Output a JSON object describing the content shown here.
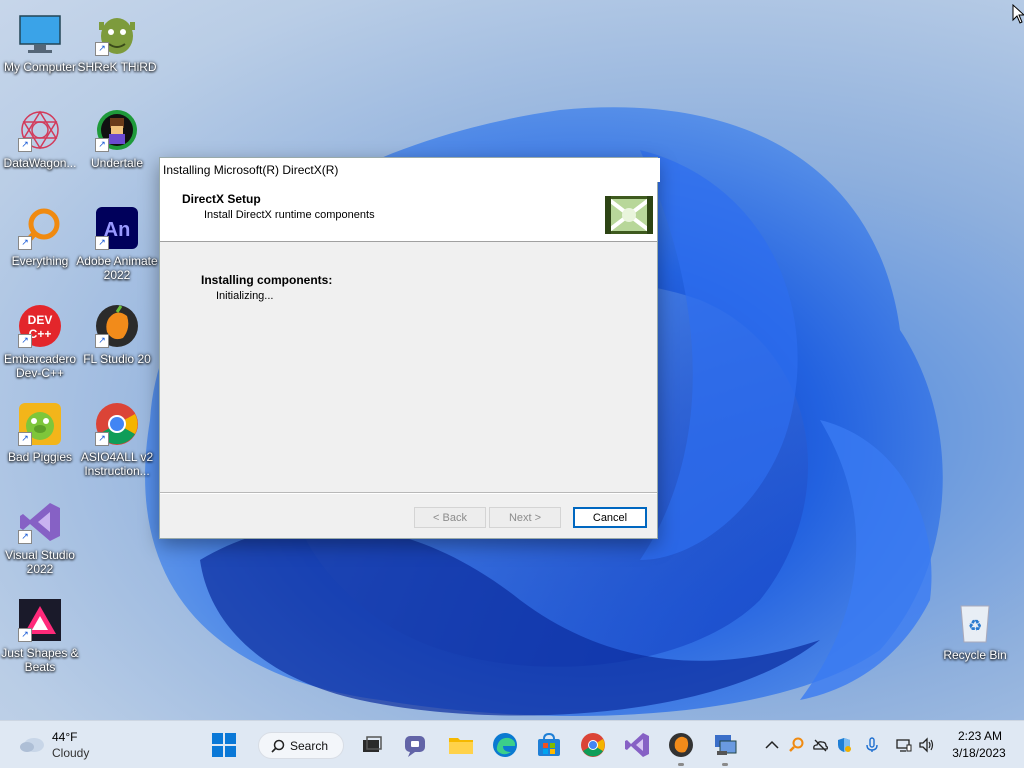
{
  "desktop": {
    "icons": [
      {
        "label": "My Computer"
      },
      {
        "label": "SHReK THiRD"
      },
      {
        "label": "DataWagon..."
      },
      {
        "label": "Undertale"
      },
      {
        "label": "Everything"
      },
      {
        "label": "Adobe Animate 2022"
      },
      {
        "label": "Embarcadero Dev-C++"
      },
      {
        "label": "FL Studio 20"
      },
      {
        "label": "Bad Piggies"
      },
      {
        "label": "ASIO4ALL v2 Instruction..."
      },
      {
        "label": "Visual Studio 2022"
      },
      {
        "label": "Just Shapes & Beats"
      },
      {
        "label": "Recycle Bin"
      }
    ]
  },
  "dialog": {
    "title": "Installing Microsoft(R) DirectX(R)",
    "header_title": "DirectX Setup",
    "header_subtitle": "Install DirectX runtime components",
    "status_label": "Installing components:",
    "status_detail": "Initializing...",
    "buttons": {
      "back": "< Back",
      "next": "Next >",
      "cancel": "Cancel"
    }
  },
  "taskbar": {
    "weather": {
      "temp": "44°F",
      "desc": "Cloudy"
    },
    "search_label": "Search",
    "clock": {
      "time": "2:23 AM",
      "date": "3/18/2023"
    },
    "icons": [
      "start-icon",
      "task-view-icon",
      "teams-chat-icon",
      "file-explorer-icon",
      "edge-icon",
      "store-icon",
      "chrome-icon",
      "visual-studio-icon",
      "fl-studio-icon",
      "directx-setup-icon"
    ],
    "tray_icons": [
      "chevron-up-icon",
      "everything-tray-icon",
      "onedrive-icon",
      "defender-icon",
      "microphone-icon",
      "network-icon",
      "volume-icon"
    ]
  },
  "colors": {
    "accent": "#0067c0",
    "taskbar_bg": "#dfe8f3",
    "dialog_bg": "#f0f0f0"
  }
}
